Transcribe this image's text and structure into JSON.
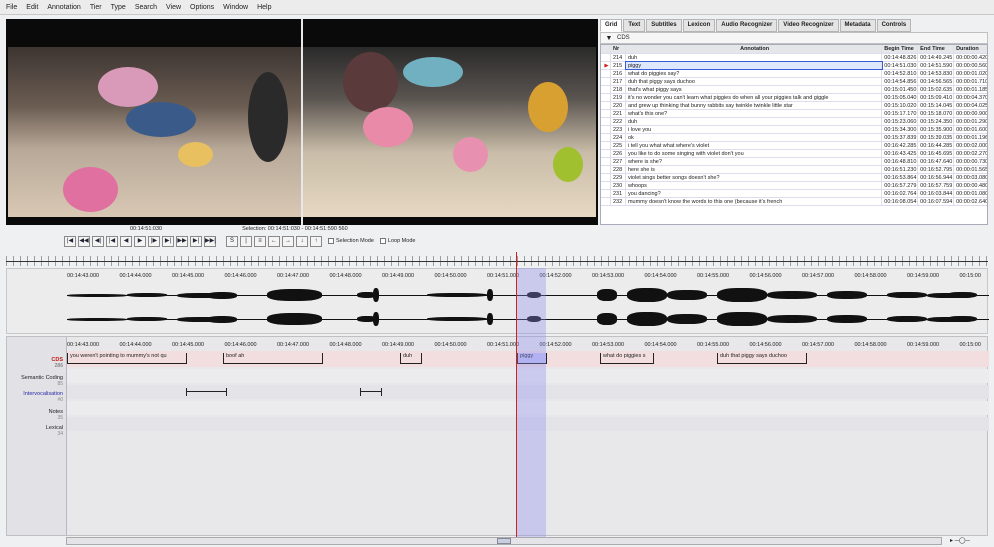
{
  "menu": [
    "File",
    "Edit",
    "Annotation",
    "Tier",
    "Type",
    "Search",
    "View",
    "Options",
    "Window",
    "Help"
  ],
  "tabs": [
    "Grid",
    "Text",
    "Subtitles",
    "Lexicon",
    "Audio Recognizer",
    "Video Recognizer",
    "Metadata",
    "Controls"
  ],
  "grid": {
    "tier": "CDS",
    "headers": [
      "Nr",
      "Annotation",
      "Begin Time",
      "End Time",
      "Duration"
    ],
    "rows": [
      {
        "nr": "214",
        "ann": "duh",
        "bt": "00:14:48.826",
        "et": "00:14:49.245",
        "dur": "00:00:00.420"
      },
      {
        "nr": "215",
        "ann": "piggy",
        "bt": "00:14:51.030",
        "et": "00:14:51.590",
        "dur": "00:00:00.560",
        "selected": true
      },
      {
        "nr": "216",
        "ann": "what do piggies say?",
        "bt": "00:14:52.810",
        "et": "00:14:53.830",
        "dur": "00:00:01.020"
      },
      {
        "nr": "217",
        "ann": "duh that piggy says duchoo",
        "bt": "00:14:54.856",
        "et": "00:14:56.565",
        "dur": "00:00:01.710"
      },
      {
        "nr": "218",
        "ann": "that's what piggy says",
        "bt": "00:15:01.450",
        "et": "00:15:02.635",
        "dur": "00:00:01.185"
      },
      {
        "nr": "219",
        "ann": "it's no wonder you can't learn what piggies do when all your piggies talk and giggle",
        "bt": "00:15:05.040",
        "et": "00:15:09.410",
        "dur": "00:00:04.370"
      },
      {
        "nr": "220",
        "ann": "and grew up thinking that bunny rabbits say twinkle twinkle little star",
        "bt": "00:15:10.020",
        "et": "00:15:14.045",
        "dur": "00:00:04.025"
      },
      {
        "nr": "221",
        "ann": "what's this one?",
        "bt": "00:15:17.170",
        "et": "00:15:18.070",
        "dur": "00:00:00.900"
      },
      {
        "nr": "222",
        "ann": "duh",
        "bt": "00:15:23.060",
        "et": "00:15:24.350",
        "dur": "00:00:01.290"
      },
      {
        "nr": "223",
        "ann": "i love you",
        "bt": "00:15:34.300",
        "et": "00:15:35.900",
        "dur": "00:00:01.600"
      },
      {
        "nr": "224",
        "ann": "ok",
        "bt": "00:15:37.839",
        "et": "00:15:39.035",
        "dur": "00:00:01.196"
      },
      {
        "nr": "225",
        "ann": "i tell you what what where's violet",
        "bt": "00:16:42.285",
        "et": "00:16:44.285",
        "dur": "00:00:02.000"
      },
      {
        "nr": "226",
        "ann": "you like to do some singing with violet don't you",
        "bt": "00:16:43.425",
        "et": "00:16:45.695",
        "dur": "00:00:02.270"
      },
      {
        "nr": "227",
        "ann": "where is she?",
        "bt": "00:16:48.810",
        "et": "00:16:47.640",
        "dur": "00:00:00.730"
      },
      {
        "nr": "228",
        "ann": "here she is",
        "bt": "00:16:51.230",
        "et": "00:16:52.795",
        "dur": "00:00:01.565"
      },
      {
        "nr": "229",
        "ann": "violet sings better songs doesn't she?",
        "bt": "00:16:53.864",
        "et": "00:16:56.944",
        "dur": "00:00:03.080"
      },
      {
        "nr": "230",
        "ann": "whoops",
        "bt": "00:16:57.279",
        "et": "00:16:57.759",
        "dur": "00:00:00.480"
      },
      {
        "nr": "231",
        "ann": "you dancing?",
        "bt": "00:16:02.764",
        "et": "00:16:03.844",
        "dur": "00:00:01.080"
      },
      {
        "nr": "232",
        "ann": "mummy doesn't know the words to this one (because it's french",
        "bt": "00:16:08.054",
        "et": "00:16:07.594",
        "dur": "00:00:02.640"
      }
    ]
  },
  "transport": {
    "time_left": "00:14:51:030",
    "selection": "Selection: 00:14:51:030 - 00:14:51:590  560",
    "buttons": [
      "|◀",
      "◀◀",
      "◀|",
      "|◀",
      "◀",
      "▶",
      "|▶",
      "▶|",
      "▶▶",
      "▶|",
      "▶▶|"
    ],
    "buttons2": [
      "S",
      "|",
      "≡",
      "←",
      "→",
      "↓",
      "↑"
    ],
    "selection_mode": "Selection Mode",
    "loop_mode": "Loop Mode"
  },
  "ruler_ticks": [
    "00:14:43.000",
    "00:14:44.000",
    "00:14:45.000",
    "00:14:46.000",
    "00:14:47.000",
    "00:14:48.000",
    "00:14:49.000",
    "00:14:50.000",
    "00:14:51.000",
    "00:14:52.000",
    "00:14:53.000",
    "00:14:54.000",
    "00:14:55.000",
    "00:14:56.000",
    "00:14:57.000",
    "00:14:58.000",
    "00:14:59.000",
    "00:15:00"
  ],
  "tiers": {
    "names": [
      {
        "label": "CDS",
        "count": "286",
        "active": true
      },
      {
        "label": "Semantic Coding",
        "count": "85"
      },
      {
        "label": "Intervocalisation",
        "count": "#0",
        "iv": true
      },
      {
        "label": "Notes",
        "count": "35"
      },
      {
        "label": "Lexical",
        "count": "34"
      }
    ],
    "cds_segments": [
      "you weren't pointing to mummy's not qu",
      "boof ah",
      "duh",
      "piggy",
      "what do piggies s",
      "duh that piggy says duchoo"
    ]
  }
}
